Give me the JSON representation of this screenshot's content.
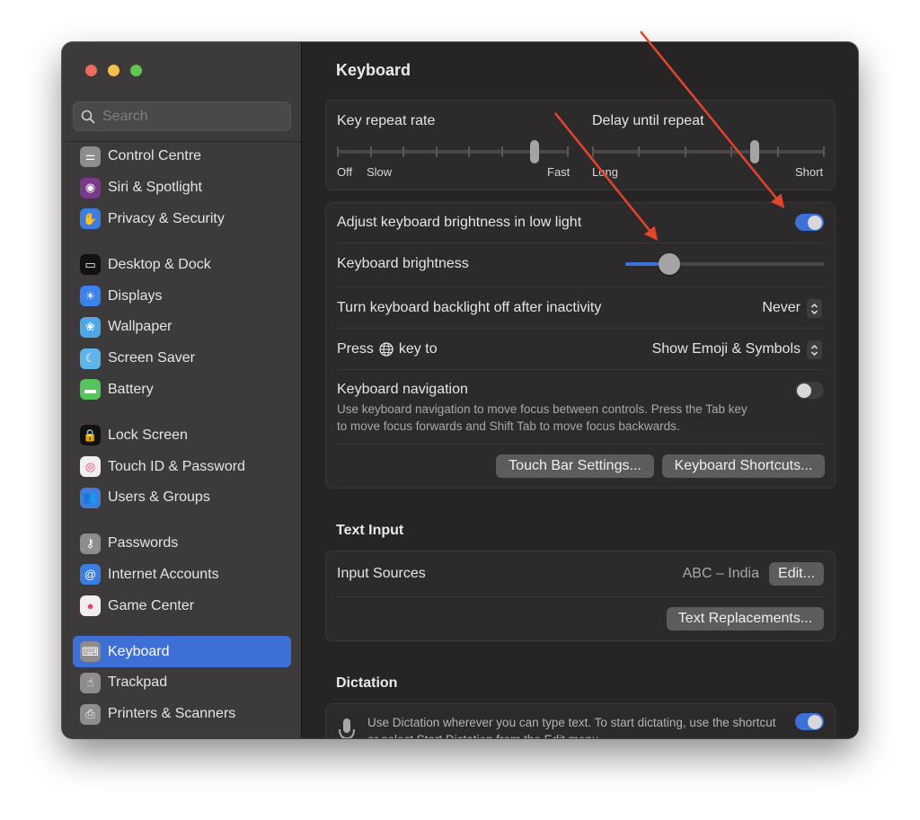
{
  "window": {
    "traffic_lights": [
      "close",
      "minimize",
      "zoom"
    ]
  },
  "sidebar": {
    "search_placeholder": "Search",
    "groups": [
      [
        {
          "label": "Control Centre",
          "icon": "control-centre-icon",
          "color": "#8e8c8d"
        },
        {
          "label": "Siri & Spotlight",
          "icon": "siri-icon",
          "color": "#7a3a8a"
        },
        {
          "label": "Privacy & Security",
          "icon": "hand-icon",
          "color": "#3d7de0"
        }
      ],
      [
        {
          "label": "Desktop & Dock",
          "icon": "dock-icon",
          "color": "#111111"
        },
        {
          "label": "Displays",
          "icon": "sun-icon",
          "color": "#3b82ec"
        },
        {
          "label": "Wallpaper",
          "icon": "flower-icon",
          "color": "#4fa7e6"
        },
        {
          "label": "Screen Saver",
          "icon": "screen-saver-icon",
          "color": "#5fb4e8"
        },
        {
          "label": "Battery",
          "icon": "battery-icon",
          "color": "#55c45a"
        }
      ],
      [
        {
          "label": "Lock Screen",
          "icon": "lock-icon",
          "color": "#111111"
        },
        {
          "label": "Touch ID & Password",
          "icon": "fingerprint-icon",
          "color": "#f2eeef"
        },
        {
          "label": "Users & Groups",
          "icon": "users-icon",
          "color": "#3d7de0"
        }
      ],
      [
        {
          "label": "Passwords",
          "icon": "key-icon",
          "color": "#8e8c8d"
        },
        {
          "label": "Internet Accounts",
          "icon": "at-icon",
          "color": "#3d7de0"
        },
        {
          "label": "Game Center",
          "icon": "game-center-icon",
          "color": "#f2eeef"
        }
      ],
      [
        {
          "label": "Keyboard",
          "icon": "keyboard-icon",
          "color": "#8e8c8d",
          "active": true
        },
        {
          "label": "Trackpad",
          "icon": "trackpad-icon",
          "color": "#8e8c8d"
        },
        {
          "label": "Printers & Scanners",
          "icon": "printer-icon",
          "color": "#8e8c8d"
        }
      ]
    ]
  },
  "main": {
    "title": "Keyboard",
    "key_repeat": {
      "label": "Key repeat rate",
      "labels": {
        "off": "Off",
        "slow": "Slow",
        "fast": "Fast"
      },
      "ticks": 8,
      "value_step": 6
    },
    "delay_repeat": {
      "label": "Delay until repeat",
      "labels": {
        "long": "Long",
        "short": "Short"
      },
      "ticks": 6,
      "value_step": 3.5
    },
    "adjust_brightness": {
      "label": "Adjust keyboard brightness in low light",
      "enabled": true
    },
    "keyboard_brightness": {
      "label": "Keyboard brightness",
      "value_fraction": 0.22
    },
    "backlight_off": {
      "label": "Turn keyboard backlight off after inactivity",
      "value": "Never"
    },
    "press_key": {
      "label_before": "Press",
      "label_after": "key to",
      "key_icon": "globe-icon",
      "value": "Show Emoji & Symbols"
    },
    "keyboard_navigation": {
      "label": "Keyboard navigation",
      "enabled": false,
      "description_line1": "Use keyboard navigation to move focus between controls. Press the Tab key",
      "description_line2": "to move focus forwards and Shift Tab to move focus backwards."
    },
    "buttons": {
      "touch_bar": "Touch Bar Settings...",
      "shortcuts": "Keyboard Shortcuts..."
    },
    "text_input": {
      "title": "Text Input",
      "input_sources_label": "Input Sources",
      "input_sources_value": "ABC – India",
      "edit_button": "Edit...",
      "replacements_button": "Text Replacements..."
    },
    "dictation": {
      "title": "Dictation",
      "enabled": true,
      "description_line1": "Use Dictation wherever you can type text. To start dictating, use the shortcut",
      "description_line2": "or select Start Dictation from the Edit menu."
    }
  },
  "annotations": {
    "arrow_color": "#e2452c",
    "count": 2
  },
  "colors": {
    "accent": "#3d6fd6",
    "toggle_on": "#3c72d8"
  }
}
